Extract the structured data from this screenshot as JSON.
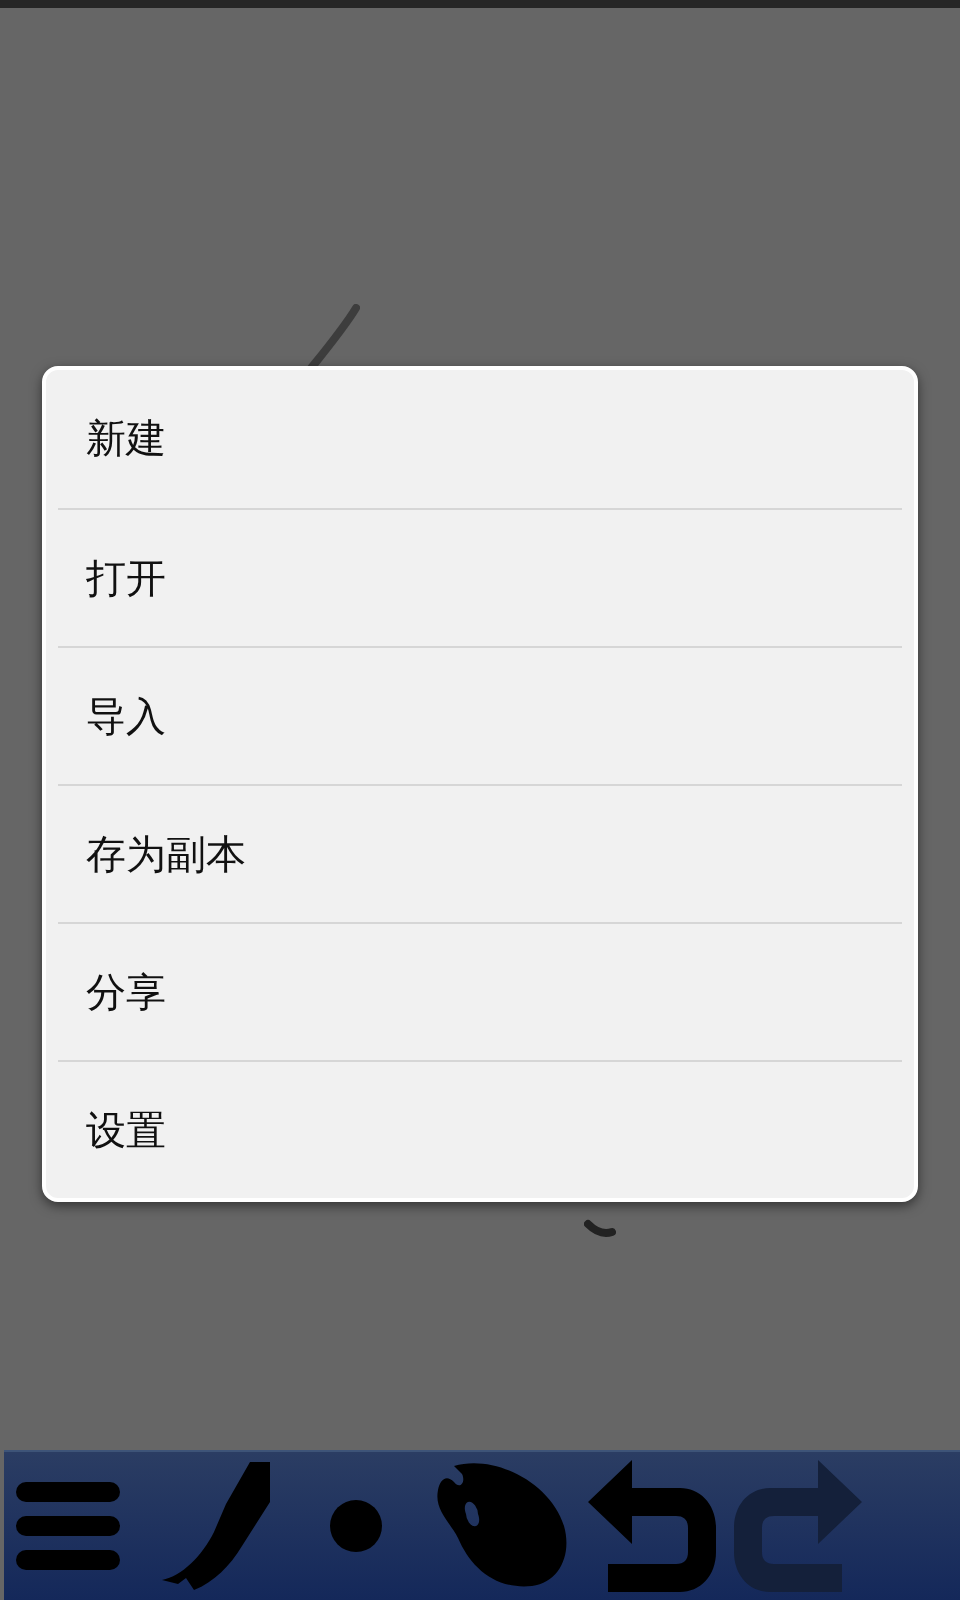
{
  "menu": {
    "items": [
      {
        "label": "新建"
      },
      {
        "label": "打开"
      },
      {
        "label": "导入"
      },
      {
        "label": "存为副本"
      },
      {
        "label": "分享"
      },
      {
        "label": "设置"
      }
    ]
  },
  "toolbar": {
    "tools": [
      {
        "kind": "menu",
        "disabled": false
      },
      {
        "kind": "brush",
        "disabled": false
      },
      {
        "kind": "dot",
        "disabled": false
      },
      {
        "kind": "palette",
        "disabled": false
      },
      {
        "kind": "undo",
        "disabled": false
      },
      {
        "kind": "redo",
        "disabled": true
      }
    ]
  }
}
